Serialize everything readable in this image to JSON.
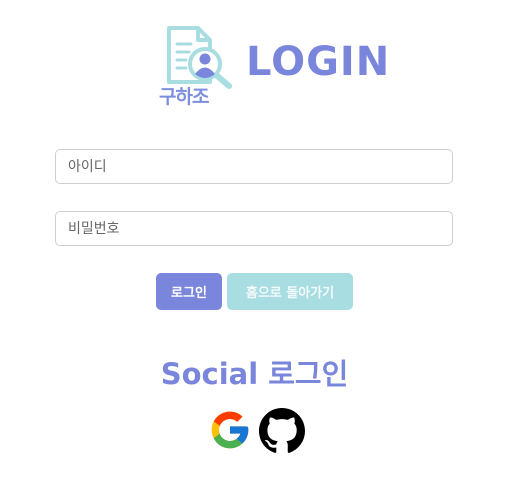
{
  "logo": {
    "text": "구하조",
    "icon": "document-search-icon"
  },
  "header": {
    "title": "LOGIN"
  },
  "form": {
    "id_placeholder": "아이디",
    "id_value": "",
    "password_placeholder": "비밀번호",
    "password_value": "",
    "login_label": "로그인",
    "home_label": "홈으로 돌아가기"
  },
  "social": {
    "title": "Social 로그인",
    "providers": [
      "google-icon",
      "github-icon"
    ]
  },
  "colors": {
    "primary": "#7a86dc",
    "secondary": "#a8dde2",
    "logo_accent": "#a8dde2"
  }
}
